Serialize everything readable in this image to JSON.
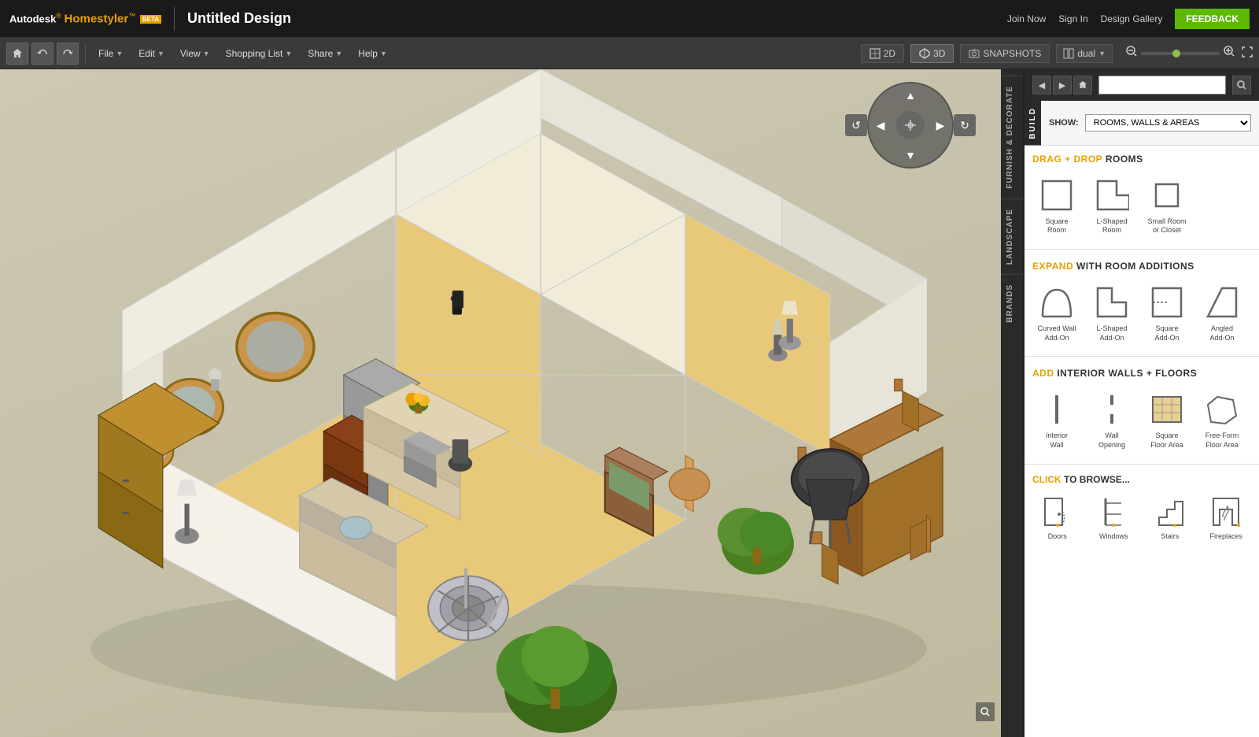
{
  "app": {
    "name": "Autodesk",
    "product": "Homestyler™",
    "beta": "BETA",
    "design_title": "Untitled Design"
  },
  "top_nav": {
    "join_now": "Join Now",
    "sign_in": "Sign In",
    "design_gallery": "Design Gallery",
    "feedback": "FEEDBACK"
  },
  "toolbar": {
    "file": "File",
    "edit": "Edit",
    "view": "View",
    "shopping_list": "Shopping List",
    "share": "Share",
    "help": "Help",
    "view_2d": "2D",
    "view_3d": "3D",
    "snapshots": "SNAPSHOTS",
    "dual": "dual"
  },
  "panel": {
    "build_label": "BUILD",
    "show_label": "SHOW:",
    "show_option": "ROOMS, WALLS & AREAS",
    "search_placeholder": ""
  },
  "drag_drop": {
    "title_highlight": "DRAG + DROP",
    "title_normal": " ROOMS",
    "items": [
      {
        "label": "Square\nRoom",
        "shape": "square"
      },
      {
        "label": "L-Shaped\nRoom",
        "shape": "l-shaped"
      },
      {
        "label": "Small Room\nor Closet",
        "shape": "small"
      }
    ]
  },
  "expand": {
    "title_highlight": "EXPAND",
    "title_normal": " WITH ROOM ADDITIONS",
    "items": [
      {
        "label": "Curved Wall\nAdd-On",
        "shape": "curved"
      },
      {
        "label": "L-Shaped\nAdd-On",
        "shape": "l-add"
      },
      {
        "label": "Square\nAdd-On",
        "shape": "square-add"
      },
      {
        "label": "Angled\nAdd-On",
        "shape": "angled"
      }
    ]
  },
  "interior": {
    "title_highlight": "ADD",
    "title_normal": " INTERIOR WALLS + FLOORS",
    "items": [
      {
        "label": "Interior\nWall",
        "shape": "int-wall"
      },
      {
        "label": "Wall\nOpening",
        "shape": "wall-opening"
      },
      {
        "label": "Square\nFloor Area",
        "shape": "sq-floor"
      },
      {
        "label": "Free-Form\nFloor Area",
        "shape": "free-floor"
      }
    ]
  },
  "browse": {
    "title_highlight": "CLICK",
    "title_normal": " TO BROWSE...",
    "items": [
      {
        "label": "Doors",
        "shape": "door"
      },
      {
        "label": "Windows",
        "shape": "window"
      },
      {
        "label": "Stairs",
        "shape": "stairs"
      },
      {
        "label": "Fireplaces",
        "shape": "fireplace"
      }
    ]
  },
  "side_tabs": [
    {
      "label": "FURNISH & DECORATE",
      "active": false
    },
    {
      "label": "LANDSCAPE",
      "active": false
    },
    {
      "label": "BRANDS",
      "active": false
    }
  ],
  "nav_control": {
    "up": "▲",
    "down": "▼",
    "left": "◀",
    "right": "▶",
    "rotate_left": "↺",
    "rotate_right": "↻"
  }
}
